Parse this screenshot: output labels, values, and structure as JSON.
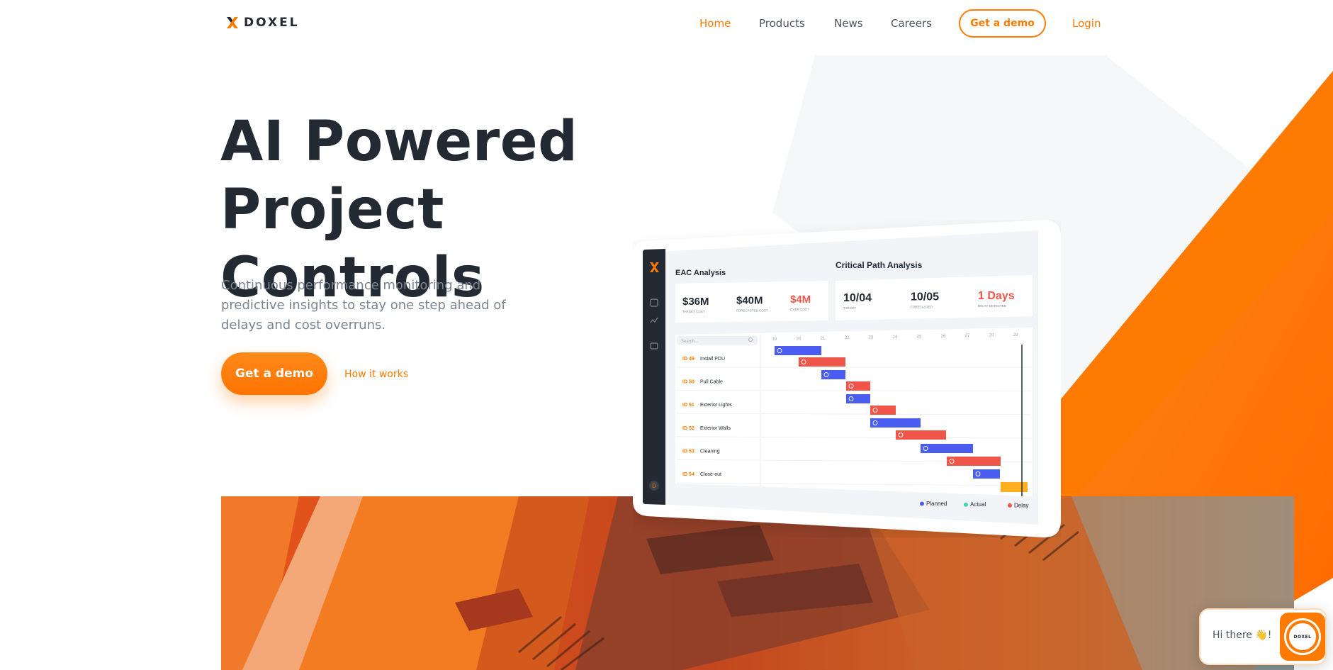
{
  "brand": {
    "name": "DOXEL",
    "accent": "#ff7a00",
    "dark": "#232a33"
  },
  "nav": {
    "items": [
      {
        "label": "Home",
        "active": true
      },
      {
        "label": "Products",
        "active": false
      },
      {
        "label": "News",
        "active": false
      },
      {
        "label": "Careers",
        "active": false
      }
    ],
    "demo_label": "Get a demo",
    "login_label": "Login"
  },
  "hero": {
    "title_line1": "AI Powered Project",
    "title_line2": "Controls",
    "subtitle": "Continuous performance monitoring and predictive insights to stay one step ahead of delays and cost overruns.",
    "cta_label": "Get a demo",
    "secondary_label": "How it works"
  },
  "dashboard": {
    "eac_title": "EAC Analysis",
    "cpa_title": "Critical Path Analysis",
    "eac_stats": [
      {
        "value": "$36M",
        "label": "TARGET COST",
        "color": "#232a33"
      },
      {
        "value": "$40M",
        "label": "FORECASTED COST",
        "color": "#232a33"
      },
      {
        "value": "$4M",
        "label": "OVER COST",
        "color": "#f0554a"
      }
    ],
    "cpa_stats": [
      {
        "value": "10/04",
        "label": "TARGET",
        "color": "#232a33"
      },
      {
        "value": "10/05",
        "label": "FORECASTED",
        "color": "#232a33"
      },
      {
        "value": "1 Days",
        "label": "DELAY DETECTED",
        "color": "#f0554a"
      }
    ],
    "search_placeholder": "Search...",
    "day_ticks": [
      "19",
      "20",
      "21",
      "22",
      "23",
      "24",
      "25",
      "26",
      "27",
      "28",
      "29"
    ],
    "tasks": [
      {
        "id": "ID 49",
        "name": "Install PDU"
      },
      {
        "id": "ID 50",
        "name": "Pull Cable"
      },
      {
        "id": "ID 51",
        "name": "Exterior Lights"
      },
      {
        "id": "ID 52",
        "name": "Exterior Walls"
      },
      {
        "id": "ID 53",
        "name": "Cleaning"
      },
      {
        "id": "ID 54",
        "name": "Close-out"
      }
    ],
    "legend": [
      {
        "label": "Planned",
        "color": "#4b5cf0"
      },
      {
        "label": "Actual",
        "color": "#3ed6b0"
      },
      {
        "label": "Delay",
        "color": "#f0554a"
      }
    ],
    "sidebar_badge": "D"
  },
  "chat": {
    "greeting": "Hi there 👋!",
    "logo_text": "DOXEL"
  }
}
